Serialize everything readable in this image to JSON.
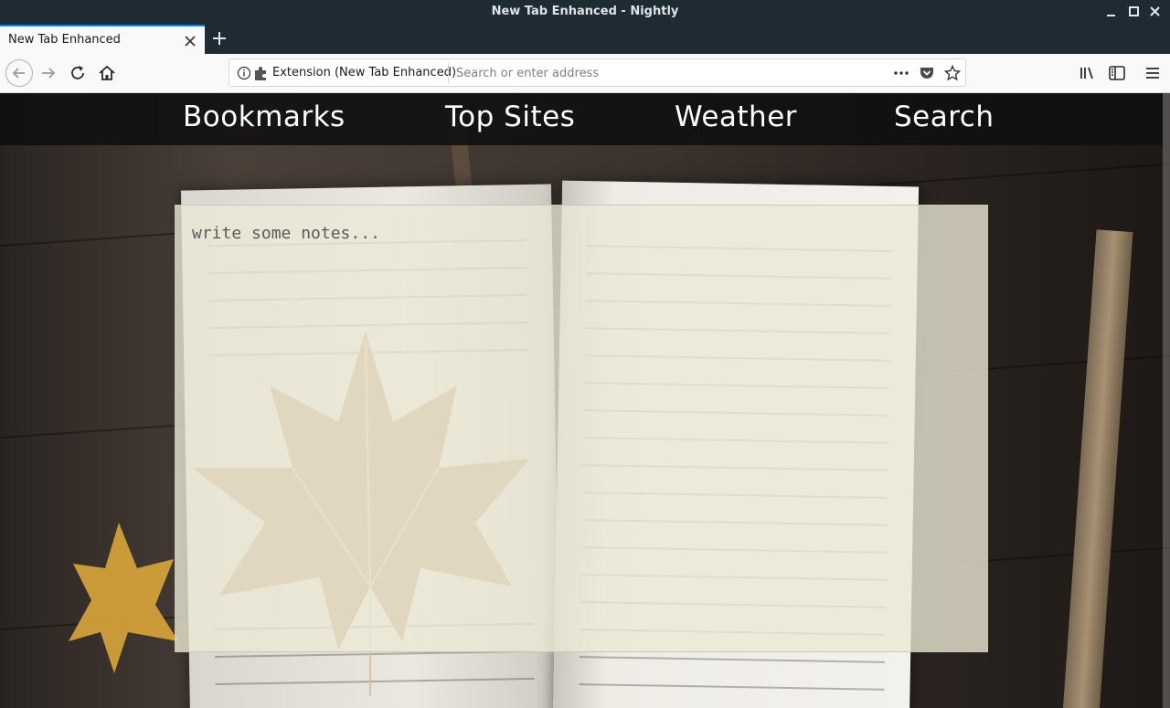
{
  "window": {
    "title": "New Tab Enhanced - Nightly"
  },
  "tabs": [
    {
      "label": "New Tab Enhanced"
    }
  ],
  "urlbar": {
    "identity_label": "Extension (New Tab Enhanced)",
    "placeholder": "Search or enter address"
  },
  "menu": {
    "items": [
      {
        "label": "Bookmarks"
      },
      {
        "label": "Top Sites"
      },
      {
        "label": "Weather"
      },
      {
        "label": "Search"
      }
    ]
  },
  "notes": {
    "placeholder": "write some notes..."
  },
  "colors": {
    "titlebar": "#1f2b33",
    "toolbar": "#f9f9fa",
    "tab_accent": "#0a84ff",
    "menubar": "#0f0f0f",
    "notes_bg": "#ece8d6"
  },
  "icons": [
    "minimize-icon",
    "maximize-icon",
    "close-window-icon",
    "tab-close-icon",
    "new-tab-icon",
    "back-icon",
    "forward-icon",
    "reload-icon",
    "home-icon",
    "info-icon",
    "extension-icon",
    "page-actions-icon",
    "pocket-icon",
    "bookmark-star-icon",
    "library-icon",
    "sidebar-icon",
    "hamburger-menu-icon"
  ]
}
